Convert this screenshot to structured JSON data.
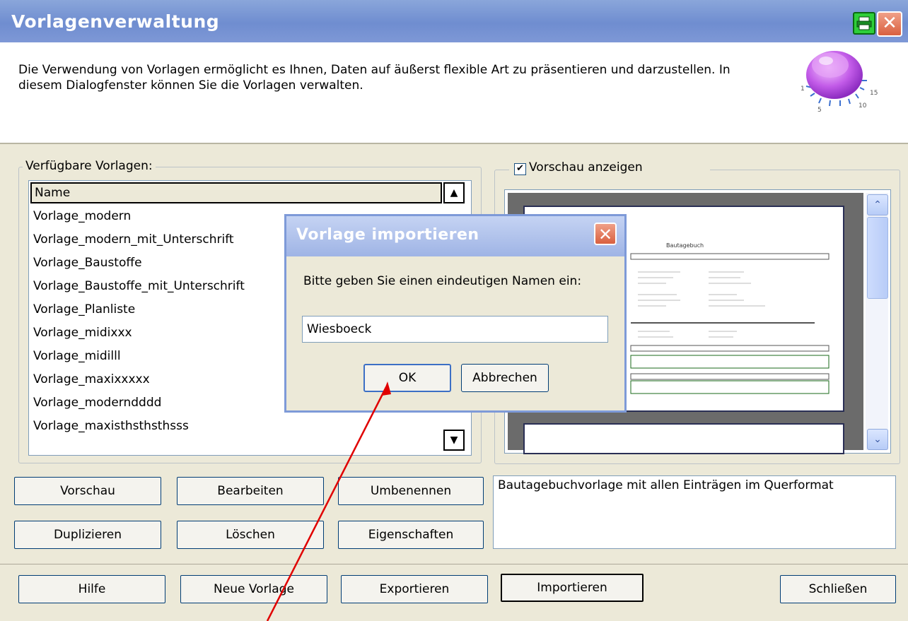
{
  "window": {
    "title": "Vorlagenverwaltung",
    "intro_text": "Die Verwendung von Vorlagen ermöglicht es Ihnen, Daten auf äußerst flexible Art zu präsentieren und darzustellen. In diesem Dialogfenster können Sie die Vorlagen verwalten.",
    "close_glyph": "✕"
  },
  "knob": {
    "labels": [
      "1",
      "5",
      "10",
      "15"
    ]
  },
  "templates": {
    "legend": "Verfügbare Vorlagen:",
    "column_header": "Name",
    "items": [
      "Vorlage_modern",
      "Vorlage_modern_mit_Unterschrift",
      "Vorlage_Baustoffe",
      "Vorlage_Baustoffe_mit_Unterschrift",
      "Vorlage_Planliste",
      "Vorlage_midixxx",
      "Vorlage_midilll",
      "Vorlage_maxixxxxx",
      "Vorlage_moderndddd",
      "Vorlage_maxisthsthsthsss"
    ]
  },
  "preview": {
    "checkbox_label": "Vorschau anzeigen",
    "checked": true,
    "page_title": "Bautagebuch"
  },
  "description": "Bautagebuchvorlage mit allen Einträgen im Querformat",
  "actions": {
    "preview": "Vorschau",
    "edit": "Bearbeiten",
    "rename": "Umbenennen",
    "duplicate": "Duplizieren",
    "delete": "Löschen",
    "properties": "Eigenschaften"
  },
  "footer": {
    "help": "Hilfe",
    "new": "Neue Vorlage",
    "export": "Exportieren",
    "import": "Importieren",
    "close": "Schließen"
  },
  "dialog": {
    "title": "Vorlage importieren",
    "prompt": "Bitte geben Sie einen eindeutigen Namen ein:",
    "input_value": "Wiesboeck",
    "ok": "OK",
    "cancel": "Abbrechen"
  },
  "colors": {
    "titlebar": "#7e98d6",
    "dialog_border": "#7e9ad8",
    "annotation_arrow": "#e00000"
  }
}
